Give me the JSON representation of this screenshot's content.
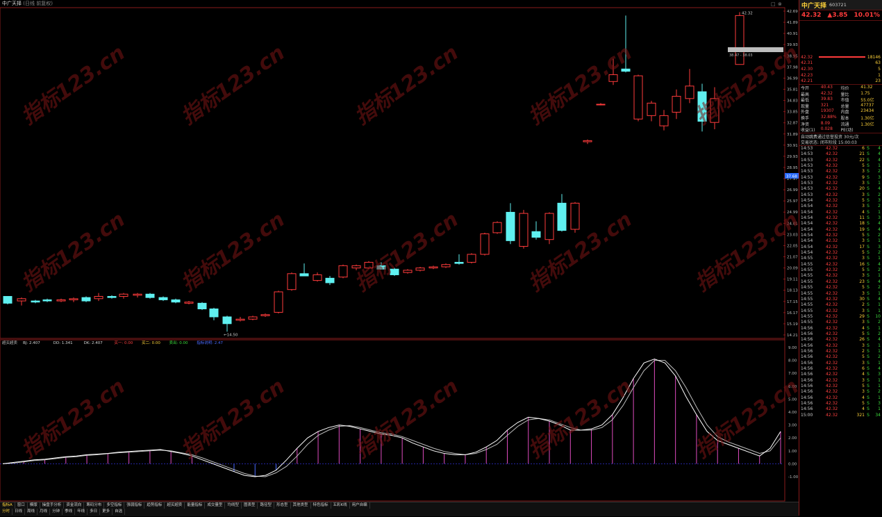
{
  "window": {
    "title": "中广天择",
    "subtitle": "(日线 前复权)",
    "max_icon": "□",
    "close_icon": "⊗"
  },
  "main_chart": {
    "price_axis": [
      "42.69",
      "41.89",
      "40.91",
      "39.93",
      "38.95",
      "37.98",
      "36.99",
      "35.81",
      "34.83",
      "33.85",
      "32.87",
      "31.89",
      "30.91",
      "29.93",
      "28.95",
      "27.97",
      "26.99",
      "25.97",
      "24.99",
      "24.01",
      "23.03",
      "22.05",
      "21.07",
      "20.09",
      "19.11",
      "18.13",
      "17.15",
      "16.17",
      "15.19",
      "14.21"
    ],
    "current_price_tag": "37.68",
    "low_marker": "14.50",
    "high_marker": "42.32",
    "range_label": "38.47 - 38.03"
  },
  "indicator": {
    "name": "超买超卖",
    "legend": [
      {
        "label": "BJ: 2.407",
        "color": "#d6d6d6"
      },
      {
        "label": "DD: 1.341",
        "color": "#d6d6d6"
      },
      {
        "label": "DK: 2.407",
        "color": "#d6d6d6"
      },
      {
        "label": "买一: 0.00",
        "color": "#ff4040"
      },
      {
        "label": "买二: 0.00",
        "color": "#ffd23a"
      },
      {
        "label": "卖出: 0.00",
        "color": "#3ddc3d"
      },
      {
        "label": "指标说明: 2.47",
        "color": "#4a6bff"
      }
    ],
    "axis": [
      "9.00",
      "8.00",
      "7.00",
      "6.00",
      "5.00",
      "4.00",
      "3.00",
      "2.00",
      "1.00",
      "0.00",
      "-1.00"
    ],
    "main_line": [
      0.0,
      0.1,
      0.2,
      0.3,
      0.35,
      0.45,
      0.55,
      0.6,
      0.7,
      0.75,
      0.8,
      0.9,
      0.95,
      1.0,
      1.05,
      1.1,
      0.95,
      0.8,
      0.6,
      0.3,
      0.0,
      -0.3,
      -0.6,
      -0.9,
      -1.0,
      -0.9,
      -0.5,
      0.3,
      1.2,
      2.0,
      2.5,
      2.8,
      3.0,
      2.9,
      2.7,
      2.5,
      2.3,
      2.2,
      2.0,
      1.6,
      1.3,
      1.0,
      0.8,
      0.7,
      0.7,
      0.9,
      1.3,
      1.8,
      2.6,
      3.2,
      3.6,
      3.5,
      3.3,
      3.0,
      2.6,
      2.6,
      2.7,
      3.0,
      3.8,
      5.1,
      6.6,
      7.8,
      8.1,
      7.8,
      6.8,
      5.2,
      3.8,
      2.5,
      1.8,
      1.5,
      1.2,
      0.9,
      0.6,
      1.2,
      2.5
    ],
    "signal_line": [
      0.0,
      0.05,
      0.15,
      0.25,
      0.3,
      0.4,
      0.5,
      0.55,
      0.65,
      0.7,
      0.78,
      0.85,
      0.9,
      0.95,
      1.0,
      1.05,
      1.0,
      0.85,
      0.7,
      0.45,
      0.15,
      -0.15,
      -0.45,
      -0.75,
      -0.95,
      -1.0,
      -0.7,
      -0.2,
      0.6,
      1.5,
      2.2,
      2.6,
      2.9,
      2.95,
      2.8,
      2.6,
      2.4,
      2.3,
      2.1,
      1.8,
      1.5,
      1.2,
      0.95,
      0.8,
      0.7,
      0.8,
      1.1,
      1.5,
      2.2,
      2.9,
      3.4,
      3.5,
      3.4,
      3.1,
      2.8,
      2.6,
      2.6,
      2.8,
      3.4,
      4.5,
      5.9,
      7.2,
      8.0,
      8.0,
      7.2,
      5.9,
      4.4,
      3.0,
      2.1,
      1.7,
      1.4,
      1.1,
      0.8,
      1.0,
      2.0
    ]
  },
  "watermark": "指标123.cn",
  "quote": {
    "name": "中广天择",
    "code": "603721",
    "price": "42.32",
    "change": "▲3.85",
    "pct": "10.01%",
    "order_book": [
      {
        "price": "42.32",
        "vol": "18146"
      },
      {
        "price": "42.31",
        "vol": "63"
      },
      {
        "price": "42.30",
        "vol": "5"
      },
      {
        "price": "42.23",
        "vol": "1"
      },
      {
        "price": "42.21",
        "vol": "23"
      }
    ],
    "stats": [
      [
        "今开",
        "40.43",
        "均价",
        "41.32"
      ],
      [
        "最高",
        "42.32",
        "量比",
        "1.75"
      ],
      [
        "最低",
        "39.83",
        "市值",
        "55.0亿"
      ],
      [
        "现量",
        "321",
        "总量",
        "47737"
      ],
      [
        "外盘",
        "19307",
        "内盘",
        "23434"
      ],
      [
        "换手",
        "32.88%",
        "股本",
        "1.30亿"
      ],
      [
        "净资",
        "8.09",
        "流通",
        "1.30亿"
      ],
      [
        "收益(1)",
        "0.028",
        "PE(动)",
        ""
      ]
    ],
    "info_lines": [
      "自动跳费通过信誉投资 30元/次",
      "交易状态: 闭市阶段 15:00:03"
    ],
    "ticks": [
      [
        "14:53",
        "42.32",
        "6",
        "S",
        "4"
      ],
      [
        "14:53",
        "42.32",
        "21",
        "S",
        "4"
      ],
      [
        "14:53",
        "42.32",
        "22",
        "S",
        "4"
      ],
      [
        "14:53",
        "42.32",
        "5",
        "S",
        "1"
      ],
      [
        "14:53",
        "42.32",
        "3",
        "S",
        "2"
      ],
      [
        "14:53",
        "42.32",
        "9",
        "S",
        "3"
      ],
      [
        "14:53",
        "42.32",
        "3",
        "S",
        "1"
      ],
      [
        "14:53",
        "42.32",
        "20",
        "S",
        "4"
      ],
      [
        "14:53",
        "42.32",
        "3",
        "S",
        "2"
      ],
      [
        "14:54",
        "42.32",
        "5",
        "S",
        "3"
      ],
      [
        "14:54",
        "42.32",
        "3",
        "S",
        "2"
      ],
      [
        "14:54",
        "42.32",
        "4",
        "S",
        "1"
      ],
      [
        "14:54",
        "42.32",
        "11",
        "S",
        "3"
      ],
      [
        "14:54",
        "42.32",
        "18",
        "S",
        "4"
      ],
      [
        "14:54",
        "42.32",
        "19",
        "S",
        "4"
      ],
      [
        "14:54",
        "42.32",
        "5",
        "S",
        "2"
      ],
      [
        "14:54",
        "42.32",
        "3",
        "S",
        "1"
      ],
      [
        "14:54",
        "42.32",
        "17",
        "S",
        "3"
      ],
      [
        "14:54",
        "42.32",
        "5",
        "S",
        "2"
      ],
      [
        "14:55",
        "42.32",
        "3",
        "S",
        "1"
      ],
      [
        "14:55",
        "42.32",
        "16",
        "S",
        "4"
      ],
      [
        "14:55",
        "42.32",
        "5",
        "S",
        "2"
      ],
      [
        "14:55",
        "42.32",
        "3",
        "S",
        "1"
      ],
      [
        "14:55",
        "42.32",
        "23",
        "S",
        "4"
      ],
      [
        "14:55",
        "42.32",
        "5",
        "S",
        "2"
      ],
      [
        "14:55",
        "42.32",
        "3",
        "S",
        "1"
      ],
      [
        "14:55",
        "42.32",
        "30",
        "S",
        "4"
      ],
      [
        "14:55",
        "42.32",
        "2",
        "S",
        "1"
      ],
      [
        "14:55",
        "42.32",
        "3",
        "S",
        "1"
      ],
      [
        "14:55",
        "42.32",
        "29",
        "S",
        "10"
      ],
      [
        "14:55",
        "42.32",
        "3",
        "S",
        "2"
      ],
      [
        "14:56",
        "42.32",
        "4",
        "S",
        "1"
      ],
      [
        "14:56",
        "42.32",
        "5",
        "S",
        "2"
      ],
      [
        "14:56",
        "42.32",
        "26",
        "S",
        "4"
      ],
      [
        "14:56",
        "42.32",
        "3",
        "S",
        "1"
      ],
      [
        "14:56",
        "42.32",
        "2",
        "S",
        "1"
      ],
      [
        "14:56",
        "42.32",
        "5",
        "S",
        "2"
      ],
      [
        "14:56",
        "42.32",
        "3",
        "S",
        "1"
      ],
      [
        "14:56",
        "42.32",
        "6",
        "S",
        "4"
      ],
      [
        "14:56",
        "42.32",
        "4",
        "S",
        "3"
      ],
      [
        "14:56",
        "42.32",
        "3",
        "S",
        "1"
      ],
      [
        "14:56",
        "42.32",
        "5",
        "S",
        "1"
      ],
      [
        "14:56",
        "42.32",
        "3",
        "S",
        "2"
      ],
      [
        "14:56",
        "42.32",
        "4",
        "S",
        "1"
      ],
      [
        "14:56",
        "42.32",
        "5",
        "S",
        "3"
      ],
      [
        "14:56",
        "42.32",
        "4",
        "S",
        "1"
      ],
      [
        "15:00",
        "42.32",
        "321",
        "S",
        "34"
      ]
    ]
  },
  "toolbar": {
    "row1": [
      "指标A",
      "窗口",
      "模版",
      "操盘手分析",
      "资金流向",
      "筹码分布",
      "多空指标",
      "强弱指标",
      "趋势指标",
      "超买超卖",
      "能量指标",
      "成交量型",
      "均线型",
      "图表型",
      "路径型",
      "形态型",
      "其他类型",
      "特色指标",
      "五彩K线",
      "用户自编"
    ],
    "row2": [
      "分时",
      "日线",
      "周线",
      "月线",
      "分钟",
      "季线",
      "年线",
      "多日",
      "更多",
      "自选"
    ]
  },
  "colors": {
    "up": "#ff3b3b",
    "down": "#5ff0f0",
    "panel_border": "#8a1b1b",
    "accent": "#ffd23a"
  }
}
